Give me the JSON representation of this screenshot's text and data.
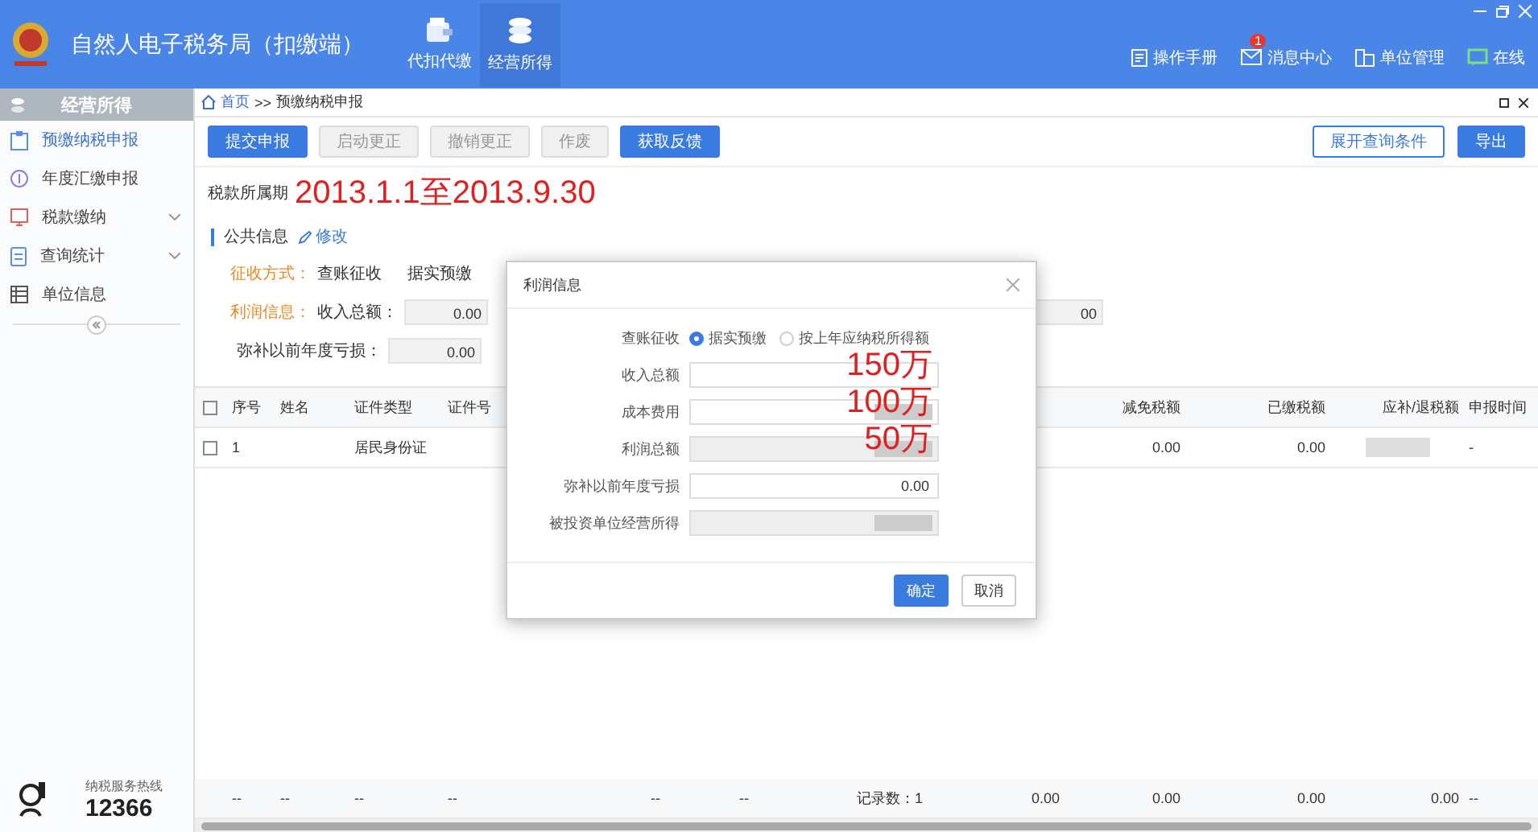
{
  "app": {
    "title": "自然人电子税务局（扣缴端）",
    "modules": [
      {
        "kind": "wallet",
        "label": "代扣代缴",
        "selected": false
      },
      {
        "kind": "coins",
        "label": "经营所得",
        "selected": true
      }
    ],
    "header_links": [
      {
        "kind": "manual",
        "label": "操作手册"
      },
      {
        "kind": "message",
        "label": "消息中心",
        "badge": "1"
      },
      {
        "kind": "unit",
        "label": "单位管理"
      },
      {
        "kind": "online",
        "label": "在线"
      }
    ]
  },
  "sidebar": {
    "title": "经营所得",
    "items": [
      {
        "kind": "clipboard",
        "label": "预缴纳税申报",
        "selected": true,
        "expandable": false
      },
      {
        "kind": "coin",
        "label": "年度汇缴申报",
        "selected": false,
        "expandable": false
      },
      {
        "kind": "monitor",
        "label": "税款缴纳",
        "selected": false,
        "expandable": true
      },
      {
        "kind": "doc",
        "label": "查询统计",
        "selected": false,
        "expandable": true
      },
      {
        "kind": "table",
        "label": "单位信息",
        "selected": false,
        "expandable": false
      }
    ],
    "hotline": {
      "label": "纳税服务热线",
      "number": "12366"
    }
  },
  "breadcrumb": {
    "home": "首页",
    "separator": ">>",
    "current": "预缴纳税申报"
  },
  "toolbar": {
    "buttons": [
      {
        "label": "提交申报",
        "disabled": false
      },
      {
        "label": "启动更正",
        "disabled": true
      },
      {
        "label": "撤销更正",
        "disabled": true
      },
      {
        "label": "作废",
        "disabled": true
      },
      {
        "label": "获取反馈",
        "disabled": false
      }
    ],
    "right_buttons": [
      {
        "label": "展开查询条件",
        "kind": "outline"
      },
      {
        "label": "导出",
        "kind": "primary"
      }
    ]
  },
  "period": {
    "label": "税款所属期",
    "annotation": "2013.1.1至2013.9.30"
  },
  "public_info": {
    "title": "公共信息",
    "edit_link": "修改",
    "method_label": "征收方式：",
    "method_value": "查账征收",
    "method_detail": "据实预缴",
    "profit_label": "利润信息：",
    "income_label": "收入总额：",
    "income_value": "0.00",
    "income_value_2": "00",
    "loss_label": "弥补以前年度亏损：",
    "loss_value": "0.00"
  },
  "table": {
    "all_checked": false,
    "columns": [
      "序号",
      "姓名",
      "证件类型",
      "证件号",
      "减免税额",
      "已缴税额",
      "应补/退税额",
      "申报时间"
    ],
    "rows": [
      {
        "checked": false,
        "index": "1",
        "id_type": "居民身份证",
        "reduction": "0.00",
        "paid": "0.00",
        "refund_redacted": true,
        "time": "-"
      }
    ],
    "footer": [
      "--",
      "--",
      "--",
      "--",
      "--",
      "--",
      "记录数：1",
      "0.00",
      "0.00",
      "0.00",
      "0.00",
      "--"
    ]
  },
  "dialog": {
    "title": "利润信息",
    "radio_label": "查账征收",
    "options": [
      {
        "label": "据实预缴",
        "selected": true
      },
      {
        "label": "按上年应纳税所得额",
        "selected": false
      }
    ],
    "fields": [
      {
        "label": "收入总额",
        "disabled": false,
        "annotation": "150万"
      },
      {
        "label": "成本费用",
        "disabled": false,
        "redacted": true,
        "annotation": "100万"
      },
      {
        "label": "利润总额",
        "disabled": true,
        "redacted": true,
        "annotation": "50万"
      },
      {
        "label": "弥补以前年度亏损",
        "disabled": false,
        "value": "0.00"
      },
      {
        "label": "被投资单位经营所得",
        "disabled": true,
        "redacted": true
      }
    ],
    "buttons": [
      {
        "label": "确定",
        "kind": "primary"
      },
      {
        "label": "取消",
        "kind": "default"
      }
    ]
  }
}
